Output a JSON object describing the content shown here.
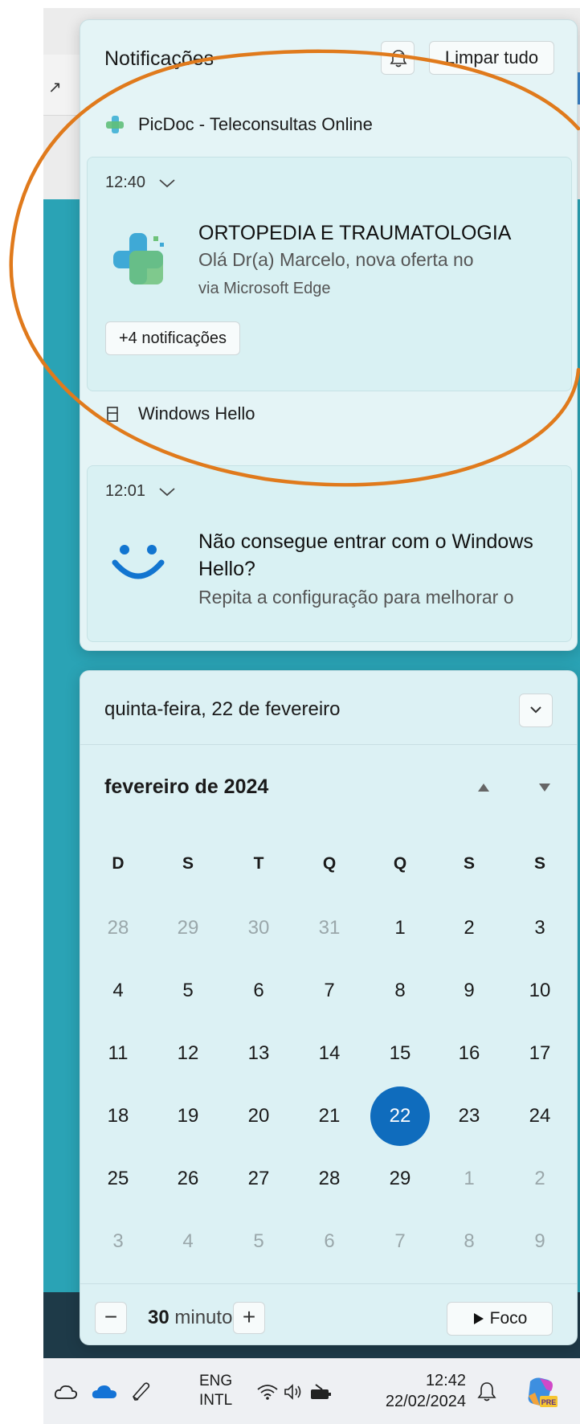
{
  "notifications": {
    "title": "Notificações",
    "clear_all": "Limpar tudo",
    "groups": [
      {
        "app": "PicDoc - Teleconsultas Online",
        "time": "12:40",
        "heading": "ORTOPEDIA E TRAUMATOLOGIA",
        "body": "Olá Dr(a) Marcelo, nova oferta no",
        "via": "via Microsoft Edge",
        "more": "+4 notificações"
      },
      {
        "app": "Windows Hello",
        "time": "12:01",
        "heading_line1": "Não consegue entrar com o Windows",
        "heading_line2": "Hello?",
        "body": "Repita a configuração para melhorar o"
      }
    ]
  },
  "calendar": {
    "date_header": "quinta-feira, 22 de fevereiro",
    "month": "fevereiro de 2024",
    "weekdays": [
      "D",
      "S",
      "T",
      "Q",
      "Q",
      "S",
      "S"
    ],
    "weeks": [
      [
        "28",
        "29",
        "30",
        "31",
        "1",
        "2",
        "3"
      ],
      [
        "4",
        "5",
        "6",
        "7",
        "8",
        "9",
        "10"
      ],
      [
        "11",
        "12",
        "13",
        "14",
        "15",
        "16",
        "17"
      ],
      [
        "18",
        "19",
        "20",
        "21",
        "22",
        "23",
        "24"
      ],
      [
        "25",
        "26",
        "27",
        "28",
        "29",
        "1",
        "2"
      ],
      [
        "3",
        "4",
        "5",
        "6",
        "7",
        "8",
        "9"
      ]
    ],
    "today": "22",
    "focus_value": "30",
    "focus_unit": "minutos",
    "focus_button": "Foco",
    "minus": "−",
    "plus": "+"
  },
  "taskbar": {
    "lang_line1": "ENG",
    "lang_line2": "INTL",
    "time": "12:42",
    "date": "22/02/2024",
    "copilot_badge": "PRE"
  },
  "colors": {
    "accent": "#0f6cbd",
    "annotation": "#e07a1c",
    "teal_background": "#2aa3b5"
  },
  "icons": [
    "snooze-bell-icon",
    "picdoc-app-icon",
    "windows-hello-icon",
    "smiley-hello-icon",
    "chevron-down-icon",
    "triangle-up-icon",
    "triangle-down-icon",
    "play-icon",
    "weather-cloud-icon",
    "onedrive-icon",
    "pen-icon",
    "wifi-icon",
    "speaker-icon",
    "battery-icon",
    "bell-icon",
    "copilot-icon"
  ]
}
